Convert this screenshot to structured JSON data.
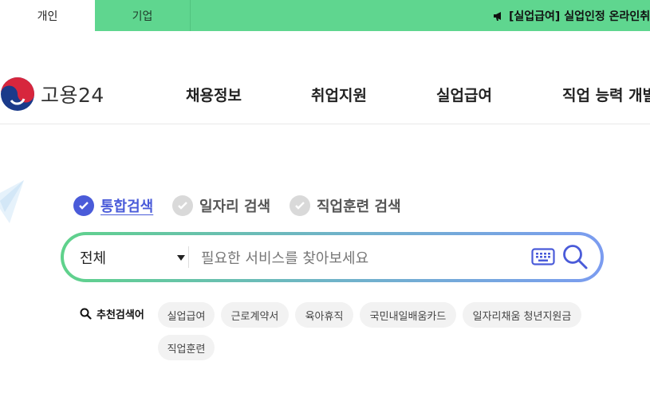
{
  "topbar": {
    "tab_personal": "개인",
    "tab_company": "기업",
    "notice": "[실업급여] 실업인정 온라인취",
    "colors": {
      "bar": "#5fd68f"
    }
  },
  "header": {
    "logo_text": "고용24",
    "menu": [
      "채용정보",
      "취업지원",
      "실업급여",
      "직업 능력 개발"
    ]
  },
  "search": {
    "options": [
      {
        "label": "통합검색",
        "active": true
      },
      {
        "label": "일자리 검색",
        "active": false
      },
      {
        "label": "직업훈련 검색",
        "active": false
      }
    ],
    "scope_value": "전체",
    "placeholder": "필요한 서비스를 찾아보세요",
    "accent_color": "#4a5bd9"
  },
  "recommended": {
    "label": "추천검색어",
    "keywords": [
      "실업급여",
      "근로계약서",
      "육아휴직",
      "국민내일배움카드",
      "일자리채움 청년지원금",
      "직업훈련"
    ]
  }
}
